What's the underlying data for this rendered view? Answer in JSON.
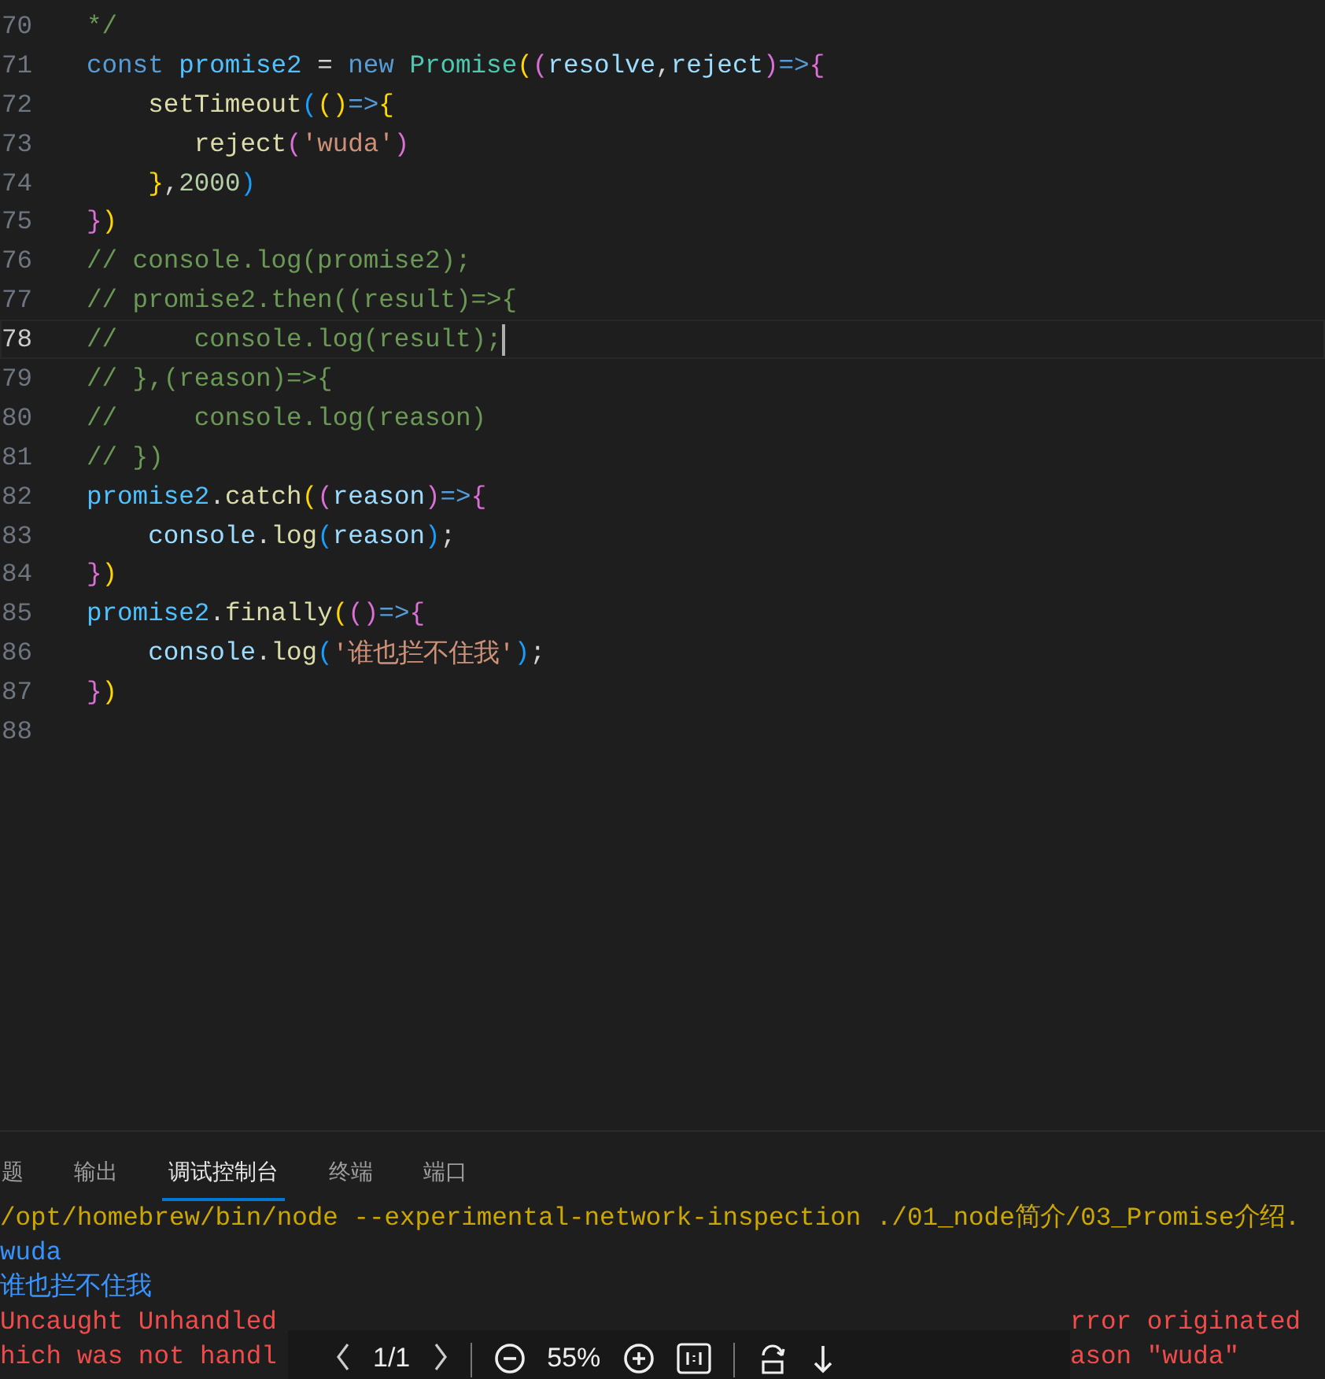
{
  "editor": {
    "lines": [
      {
        "number": "70",
        "current": false,
        "tokens": [
          {
            "t": "*/",
            "kind": "comment"
          }
        ]
      },
      {
        "number": "71",
        "current": false,
        "tokens": [
          {
            "t": "const ",
            "kind": "keyword"
          },
          {
            "t": "promise2",
            "kind": "const"
          },
          {
            "t": " = ",
            "kind": "punct"
          },
          {
            "t": "new ",
            "kind": "keyword"
          },
          {
            "t": "Promise",
            "kind": "class"
          },
          {
            "t": "(",
            "kind": "b1"
          },
          {
            "t": "(",
            "kind": "b2"
          },
          {
            "t": "resolve",
            "kind": "param"
          },
          {
            "t": ",",
            "kind": "punct"
          },
          {
            "t": "reject",
            "kind": "param"
          },
          {
            "t": ")",
            "kind": "b2"
          },
          {
            "t": "=>",
            "kind": "keyword"
          },
          {
            "t": "{",
            "kind": "b2"
          }
        ]
      },
      {
        "number": "72",
        "current": false,
        "tokens": [
          {
            "t": "    setTimeout",
            "kind": "func"
          },
          {
            "t": "(",
            "kind": "b3"
          },
          {
            "t": "()",
            "kind": "b1"
          },
          {
            "t": "=>",
            "kind": "keyword"
          },
          {
            "t": "{",
            "kind": "b1"
          }
        ]
      },
      {
        "number": "73",
        "current": false,
        "tokens": [
          {
            "t": "       reject",
            "kind": "func"
          },
          {
            "t": "(",
            "kind": "b2"
          },
          {
            "t": "'wuda'",
            "kind": "string"
          },
          {
            "t": ")",
            "kind": "b2"
          }
        ]
      },
      {
        "number": "74",
        "current": false,
        "tokens": [
          {
            "t": "    }",
            "kind": "b1"
          },
          {
            "t": ",",
            "kind": "punct"
          },
          {
            "t": "2000",
            "kind": "number"
          },
          {
            "t": ")",
            "kind": "b3"
          }
        ]
      },
      {
        "number": "75",
        "current": false,
        "tokens": [
          {
            "t": "}",
            "kind": "b2"
          },
          {
            "t": ")",
            "kind": "b1"
          }
        ]
      },
      {
        "number": "76",
        "current": false,
        "tokens": [
          {
            "t": "// console.log(promise2);",
            "kind": "comment"
          }
        ]
      },
      {
        "number": "77",
        "current": false,
        "tokens": [
          {
            "t": "// promise2.then((result)=>{",
            "kind": "comment"
          }
        ]
      },
      {
        "number": "78",
        "current": true,
        "tokens": [
          {
            "t": "//     console.log(result);",
            "kind": "comment"
          }
        ]
      },
      {
        "number": "79",
        "current": false,
        "tokens": [
          {
            "t": "// },(reason)=>{",
            "kind": "comment"
          }
        ]
      },
      {
        "number": "80",
        "current": false,
        "tokens": [
          {
            "t": "//     console.log(reason)",
            "kind": "comment"
          }
        ]
      },
      {
        "number": "81",
        "current": false,
        "tokens": [
          {
            "t": "// })",
            "kind": "comment"
          }
        ]
      },
      {
        "number": "82",
        "current": false,
        "tokens": [
          {
            "t": "promise2",
            "kind": "const"
          },
          {
            "t": ".",
            "kind": "punct"
          },
          {
            "t": "catch",
            "kind": "func"
          },
          {
            "t": "(",
            "kind": "b1"
          },
          {
            "t": "(",
            "kind": "b2"
          },
          {
            "t": "reason",
            "kind": "param"
          },
          {
            "t": ")",
            "kind": "b2"
          },
          {
            "t": "=>",
            "kind": "keyword"
          },
          {
            "t": "{",
            "kind": "b2"
          }
        ]
      },
      {
        "number": "83",
        "current": false,
        "tokens": [
          {
            "t": "    console",
            "kind": "param"
          },
          {
            "t": ".",
            "kind": "punct"
          },
          {
            "t": "log",
            "kind": "func"
          },
          {
            "t": "(",
            "kind": "b3"
          },
          {
            "t": "reason",
            "kind": "param"
          },
          {
            "t": ")",
            "kind": "b3"
          },
          {
            "t": ";",
            "kind": "punct"
          }
        ]
      },
      {
        "number": "84",
        "current": false,
        "tokens": [
          {
            "t": "}",
            "kind": "b2"
          },
          {
            "t": ")",
            "kind": "b1"
          }
        ]
      },
      {
        "number": "85",
        "current": false,
        "tokens": [
          {
            "t": "promise2",
            "kind": "const"
          },
          {
            "t": ".",
            "kind": "punct"
          },
          {
            "t": "finally",
            "kind": "func"
          },
          {
            "t": "(",
            "kind": "b1"
          },
          {
            "t": "()",
            "kind": "b2"
          },
          {
            "t": "=>",
            "kind": "keyword"
          },
          {
            "t": "{",
            "kind": "b2"
          }
        ]
      },
      {
        "number": "86",
        "current": false,
        "tokens": [
          {
            "t": "    console",
            "kind": "param"
          },
          {
            "t": ".",
            "kind": "punct"
          },
          {
            "t": "log",
            "kind": "func"
          },
          {
            "t": "(",
            "kind": "b3"
          },
          {
            "t": "'谁也拦不住我'",
            "kind": "string"
          },
          {
            "t": ")",
            "kind": "b3"
          },
          {
            "t": ";",
            "kind": "punct"
          }
        ]
      },
      {
        "number": "87",
        "current": false,
        "tokens": [
          {
            "t": "}",
            "kind": "b2"
          },
          {
            "t": ")",
            "kind": "b1"
          }
        ]
      },
      {
        "number": "88",
        "current": false
      }
    ]
  },
  "panel": {
    "tabs": [
      {
        "label": "题",
        "selected": false
      },
      {
        "label": "输出",
        "selected": false
      },
      {
        "label": "调试控制台",
        "selected": true
      },
      {
        "label": "终端",
        "selected": false
      },
      {
        "label": "端口",
        "selected": false
      }
    ],
    "console": [
      {
        "text": "/opt/homebrew/bin/node --experimental-network-inspection ./01_node简介/03_Promise介绍.",
        "kind": "command"
      },
      {
        "text": "wuda",
        "kind": "log"
      },
      {
        "text": "谁也拦不住我",
        "kind": "log"
      },
      {
        "text": "Uncaught Unhandled",
        "tail": "rror originated",
        "kind": "error"
      },
      {
        "text": "hich was not handl",
        "tail": "ason \"wuda\"",
        "kind": "error"
      }
    ]
  },
  "viewer_toolbar": {
    "page": "1/1",
    "zoom": "55%"
  }
}
